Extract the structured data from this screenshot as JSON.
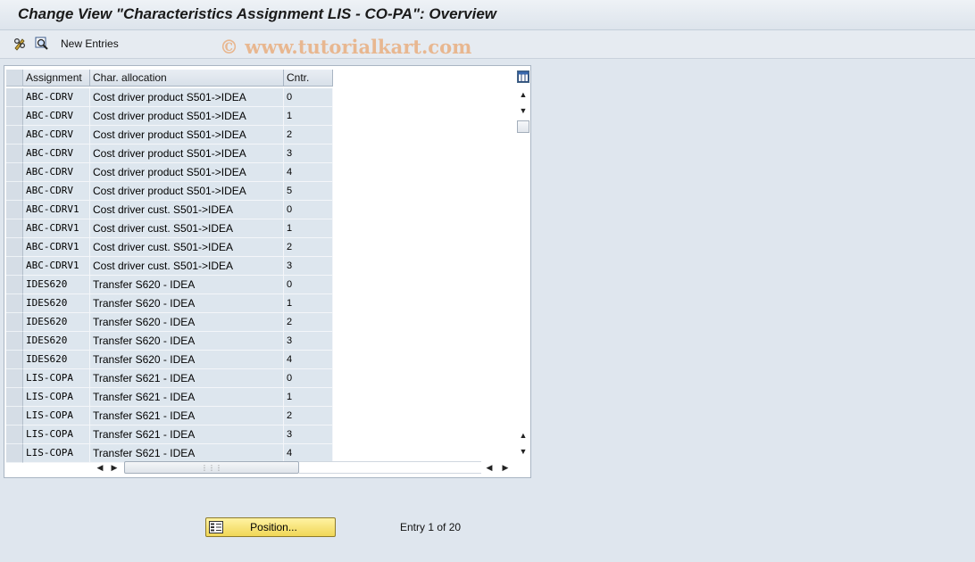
{
  "window": {
    "title": "Change View \"Characteristics Assignment LIS - CO-PA\": Overview"
  },
  "toolbar": {
    "edit_icon": "pencil-glasses-icon",
    "display_icon": "magnifier-icon",
    "new_entries_label": "New Entries",
    "watermark": "© www.tutorialkart.com"
  },
  "table": {
    "columns": [
      "Assignment",
      "Char. allocation",
      "Cntr."
    ],
    "rows": [
      {
        "assignment": "ABC-CDRV",
        "allocation": "Cost driver product S501->IDEA",
        "cntr": "0"
      },
      {
        "assignment": "ABC-CDRV",
        "allocation": "Cost driver product S501->IDEA",
        "cntr": "1"
      },
      {
        "assignment": "ABC-CDRV",
        "allocation": "Cost driver product S501->IDEA",
        "cntr": "2"
      },
      {
        "assignment": "ABC-CDRV",
        "allocation": "Cost driver product S501->IDEA",
        "cntr": "3"
      },
      {
        "assignment": "ABC-CDRV",
        "allocation": "Cost driver product S501->IDEA",
        "cntr": "4"
      },
      {
        "assignment": "ABC-CDRV",
        "allocation": "Cost driver product S501->IDEA",
        "cntr": "5"
      },
      {
        "assignment": "ABC-CDRV1",
        "allocation": "Cost driver cust. S501->IDEA",
        "cntr": "0"
      },
      {
        "assignment": "ABC-CDRV1",
        "allocation": "Cost driver cust. S501->IDEA",
        "cntr": "1"
      },
      {
        "assignment": "ABC-CDRV1",
        "allocation": "Cost driver cust. S501->IDEA",
        "cntr": "2"
      },
      {
        "assignment": "ABC-CDRV1",
        "allocation": "Cost driver cust. S501->IDEA",
        "cntr": "3"
      },
      {
        "assignment": "IDES620",
        "allocation": "Transfer S620 - IDEA",
        "cntr": "0"
      },
      {
        "assignment": "IDES620",
        "allocation": "Transfer S620 - IDEA",
        "cntr": "1"
      },
      {
        "assignment": "IDES620",
        "allocation": "Transfer S620 - IDEA",
        "cntr": "2"
      },
      {
        "assignment": "IDES620",
        "allocation": "Transfer S620 - IDEA",
        "cntr": "3"
      },
      {
        "assignment": "IDES620",
        "allocation": "Transfer S620 - IDEA",
        "cntr": "4"
      },
      {
        "assignment": "LIS-COPA",
        "allocation": "Transfer S621 - IDEA",
        "cntr": "0"
      },
      {
        "assignment": "LIS-COPA",
        "allocation": "Transfer S621 - IDEA",
        "cntr": "1"
      },
      {
        "assignment": "LIS-COPA",
        "allocation": "Transfer S621 - IDEA",
        "cntr": "2"
      },
      {
        "assignment": "LIS-COPA",
        "allocation": "Transfer S621 - IDEA",
        "cntr": "3"
      },
      {
        "assignment": "LIS-COPA",
        "allocation": "Transfer S621 - IDEA",
        "cntr": "4"
      }
    ]
  },
  "footer": {
    "position_button_label": "Position...",
    "entry_info": "Entry 1 of 20"
  },
  "colors": {
    "cell_bg": "#dde6ee",
    "button_bg": "#f0d656"
  }
}
